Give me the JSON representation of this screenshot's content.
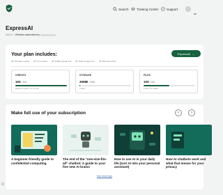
{
  "topbar": {
    "nav": [
      {
        "label": "Search",
        "icon": "search-icon"
      },
      {
        "label": "Training Center",
        "icon": "graduation-cap-icon"
      },
      {
        "label": "Support",
        "icon": "help-circle-icon"
      }
    ]
  },
  "page": {
    "title": "ExpressAI",
    "breadcrumb": [
      "Admin",
      "Wireless automation by"
    ]
  },
  "plan": {
    "title": "Your plan includes:",
    "cta_label": "ExpressAI",
    "features": [
      "100 daily credits",
      "5 AI models",
      "30MB upload limit",
      "2GB storage limit",
      "200 stored files"
    ],
    "stats": [
      {
        "label": "CREDITS",
        "value": "100",
        "total": "/ 100",
        "progress": 1.0,
        "sub": "RESETS DAILY AT 16:00"
      },
      {
        "label": "STORAGE",
        "value": "30MB",
        "total": "/ 2GB",
        "progress": 0.015,
        "sub": "USED"
      },
      {
        "label": "FILES",
        "value": "100",
        "total": "/ 200",
        "progress": 0.5,
        "sub": "FILES STORED"
      }
    ]
  },
  "subscription": {
    "title": "Make full use of your subscription",
    "articles": [
      {
        "title": "A beginner-friendly guide to confidential computing"
      },
      {
        "title": "The end of the \"one-size-fits-all\" chatbot: A guide to your five new AI brains"
      },
      {
        "title": "How to use AI in your daily life (turn AI into your personal assistant)"
      },
      {
        "title": "How AI chatbots work and what that means for your privacy"
      }
    ],
    "see_more": "See more tips"
  },
  "colors": {
    "accent": "#17623f",
    "background": "#f2f3f3",
    "thumb_dark": "#0f3f36",
    "thumb_teal": "#136b5a"
  }
}
